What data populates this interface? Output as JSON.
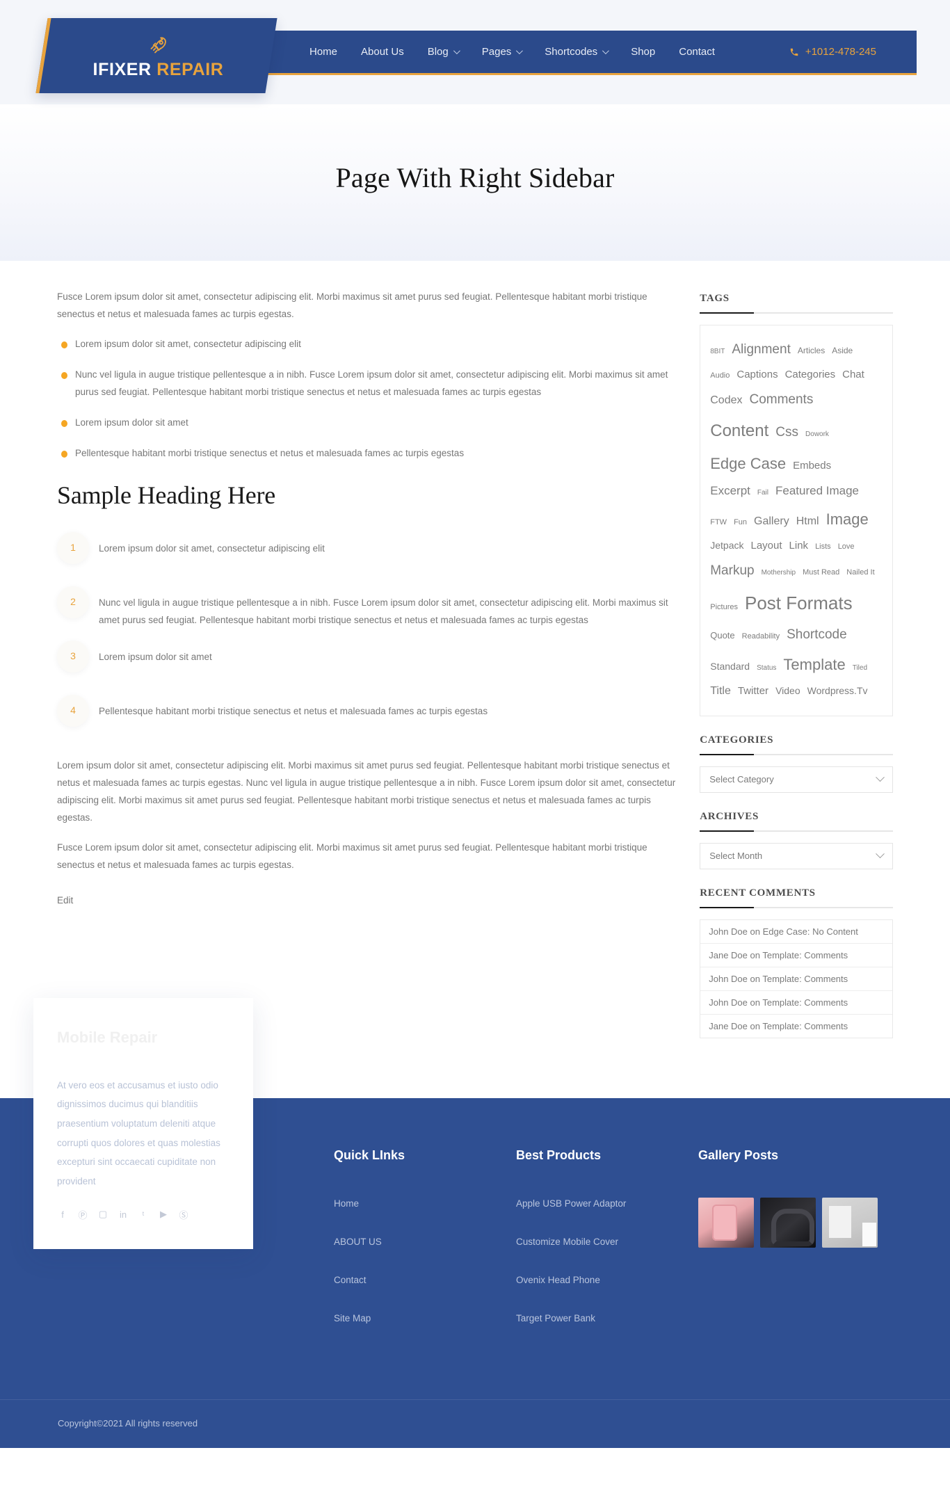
{
  "header": {
    "logo": {
      "icon": "rocket-icon",
      "text_primary": "IFIXER",
      "text_accent": "REPAIR"
    },
    "nav": [
      {
        "label": "Home",
        "has_dropdown": false
      },
      {
        "label": "About Us",
        "has_dropdown": false
      },
      {
        "label": "Blog",
        "has_dropdown": true
      },
      {
        "label": "Pages",
        "has_dropdown": true
      },
      {
        "label": "Shortcodes",
        "has_dropdown": true
      },
      {
        "label": "Shop",
        "has_dropdown": false
      },
      {
        "label": "Contact",
        "has_dropdown": false
      }
    ],
    "phone": {
      "icon": "phone-icon",
      "number": "+1012-478-245"
    },
    "colors": {
      "brand_blue": "#2b4a8b",
      "accent_gold": "#e8a33d"
    }
  },
  "page_title": "Page With Right Sidebar",
  "main": {
    "intro_paragraph": "Fusce Lorem ipsum dolor sit amet, consectetur adipiscing elit. Morbi maximus sit amet purus sed feugiat. Pellentesque habitant morbi tristique senectus et netus et malesuada fames ac turpis egestas.",
    "bullets": [
      "Lorem ipsum dolor sit amet, consectetur adipiscing elit",
      "Nunc vel ligula in augue tristique pellentesque a in nibh. Fusce Lorem ipsum dolor sit amet, consectetur adipiscing elit. Morbi maximus sit amet purus sed feugiat. Pellentesque habitant morbi tristique senectus et netus et malesuada fames ac turpis egestas",
      "Lorem ipsum dolor sit amet",
      "Pellentesque habitant morbi tristique senectus et netus et malesuada fames ac turpis egestas"
    ],
    "heading": "Sample Heading Here",
    "numbered": [
      {
        "num": "1",
        "text": "Lorem ipsum dolor sit amet, consectetur adipiscing elit"
      },
      {
        "num": "2",
        "text": "Nunc vel ligula in augue tristique pellentesque a in nibh. Fusce Lorem ipsum dolor sit amet, consectetur adipiscing elit. Morbi maximus sit amet purus sed feugiat. Pellentesque habitant morbi tristique senectus et netus et malesuada fames ac turpis egestas"
      },
      {
        "num": "3",
        "text": "Lorem ipsum dolor sit amet"
      },
      {
        "num": "4",
        "text": "Pellentesque habitant morbi tristique senectus et netus et malesuada fames ac turpis egestas"
      }
    ],
    "paragraph_2": "Lorem ipsum dolor sit amet, consectetur adipiscing elit. Morbi maximus sit amet purus sed feugiat. Pellentesque habitant morbi tristique senectus et netus et malesuada fames ac turpis egestas. Nunc vel ligula in augue tristique pellentesque a in nibh. Fusce Lorem ipsum dolor sit amet, consectetur adipiscing elit. Morbi maximus sit amet purus sed feugiat. Pellentesque habitant morbi tristique senectus et netus et malesuada fames ac turpis egestas.",
    "paragraph_3": "Fusce Lorem ipsum dolor sit amet, consectetur adipiscing elit. Morbi maximus sit amet purus sed feugiat. Pellentesque habitant morbi tristique senectus et netus et malesuada fames ac turpis egestas.",
    "edit_link": "Edit"
  },
  "sidebar": {
    "tags_title": "TAGS",
    "tags": [
      {
        "label": "8BIT",
        "size": 10
      },
      {
        "label": "Alignment",
        "size": 19
      },
      {
        "label": "Articles",
        "size": 12
      },
      {
        "label": "Aside",
        "size": 12
      },
      {
        "label": "Audio",
        "size": 11
      },
      {
        "label": "Captions",
        "size": 15
      },
      {
        "label": "Categories",
        "size": 15
      },
      {
        "label": "Chat",
        "size": 15
      },
      {
        "label": "Codex",
        "size": 16
      },
      {
        "label": "Comments",
        "size": 19
      },
      {
        "label": "Content",
        "size": 24
      },
      {
        "label": "Css",
        "size": 19
      },
      {
        "label": "Dowork",
        "size": 10
      },
      {
        "label": "Edge Case",
        "size": 22
      },
      {
        "label": "Embeds",
        "size": 15
      },
      {
        "label": "Excerpt",
        "size": 17
      },
      {
        "label": "Fail",
        "size": 10
      },
      {
        "label": "Featured Image",
        "size": 17
      },
      {
        "label": "FTW",
        "size": 11
      },
      {
        "label": "Fun",
        "size": 11
      },
      {
        "label": "Gallery",
        "size": 16
      },
      {
        "label": "Html",
        "size": 16
      },
      {
        "label": "Image",
        "size": 22
      },
      {
        "label": "Jetpack",
        "size": 14
      },
      {
        "label": "Layout",
        "size": 15
      },
      {
        "label": "Link",
        "size": 15
      },
      {
        "label": "Lists",
        "size": 11
      },
      {
        "label": "Love",
        "size": 11
      },
      {
        "label": "Markup",
        "size": 19
      },
      {
        "label": "Mothership",
        "size": 10
      },
      {
        "label": "Must Read",
        "size": 11
      },
      {
        "label": "Nailed It",
        "size": 11
      },
      {
        "label": "Pictures",
        "size": 11
      },
      {
        "label": "Post Formats",
        "size": 26
      },
      {
        "label": "Quote",
        "size": 13
      },
      {
        "label": "Readability",
        "size": 11
      },
      {
        "label": "Shortcode",
        "size": 19
      },
      {
        "label": "Standard",
        "size": 14
      },
      {
        "label": "Status",
        "size": 10
      },
      {
        "label": "Template",
        "size": 22
      },
      {
        "label": "Tiled",
        "size": 10
      },
      {
        "label": "Title",
        "size": 16
      },
      {
        "label": "Twitter",
        "size": 15
      },
      {
        "label": "Video",
        "size": 14
      },
      {
        "label": "Wordpress.Tv",
        "size": 14
      }
    ],
    "categories_title": "CATEGORIES",
    "categories_select": "Select Category",
    "archives_title": "ARCHIVES",
    "archives_select": "Select Month",
    "recent_comments_title": "RECENT COMMENTS",
    "recent_comments": [
      "John Doe on Edge Case: No Content",
      "Jane Doe on Template: Comments",
      "John Doe on Template: Comments",
      "John Doe on Template: Comments",
      "Jane Doe on Template: Comments"
    ]
  },
  "footer": {
    "promo": {
      "title": "Mobile Repair",
      "text": "At vero eos et accusamus et iusto odio dignissimos ducimus qui blanditiis praesentium voluptatum deleniti atque corrupti quos dolores et quas molestias excepturi sint occaecati cupiditate non provident",
      "social": [
        {
          "name": "facebook-icon",
          "glyph": "f"
        },
        {
          "name": "pinterest-icon",
          "glyph": "Ⓟ"
        },
        {
          "name": "instagram-icon",
          "glyph": "▢"
        },
        {
          "name": "linkedin-icon",
          "glyph": "in"
        },
        {
          "name": "twitter-icon",
          "glyph": "ᵗ"
        },
        {
          "name": "youtube-icon",
          "glyph": "▶"
        },
        {
          "name": "skype-icon",
          "glyph": "Ⓢ"
        }
      ]
    },
    "quick_links": {
      "title": "Quick LInks",
      "items": [
        "Home",
        "ABOUT US",
        "Contact",
        "Site Map"
      ]
    },
    "best_products": {
      "title": "Best Products",
      "items": [
        "Apple USB Power Adaptor",
        "Customize Mobile Cover",
        "Ovenix Head Phone",
        "Target Power Bank"
      ]
    },
    "gallery": {
      "title": "Gallery Posts",
      "thumbs": [
        "pink-phone-case-thumb",
        "black-headphones-thumb",
        "white-charger-box-thumb"
      ]
    },
    "copyright": "Copyright©2021 All rights reserved"
  }
}
